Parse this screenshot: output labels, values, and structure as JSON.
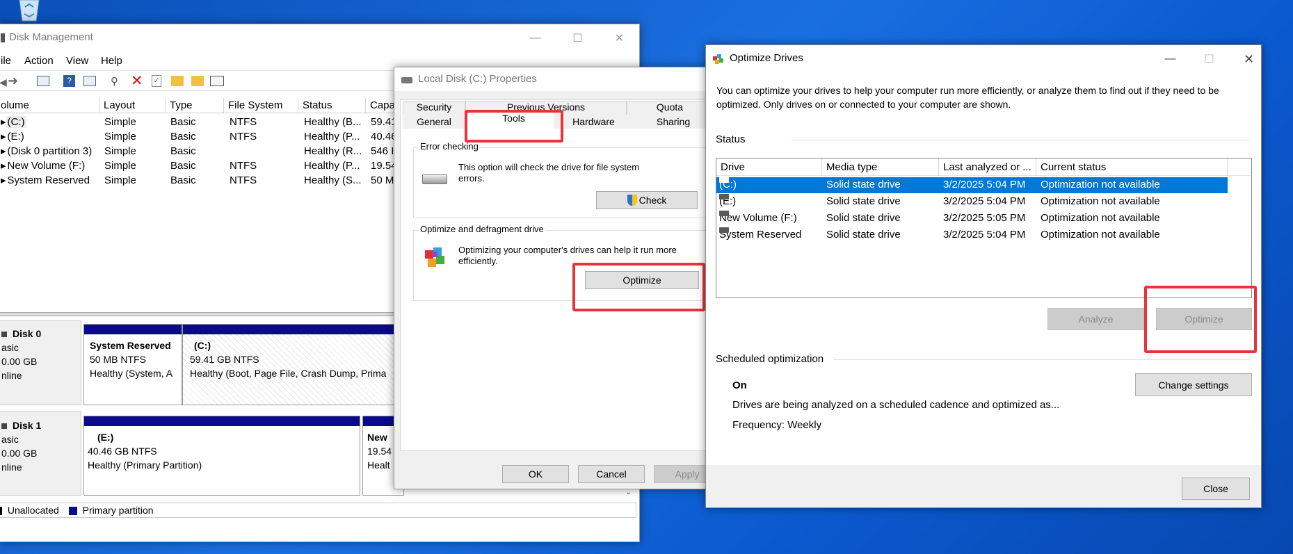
{
  "desktop": {
    "recycle_icon": "recycle-bin-icon"
  },
  "dm": {
    "title": "Disk Management",
    "menu": [
      "ile",
      "Action",
      "View",
      "Help"
    ],
    "columns": [
      "olume",
      "Layout",
      "Type",
      "File System",
      "Status",
      "Capa"
    ],
    "rows": [
      [
        "(C:)",
        "Simple",
        "Basic",
        "NTFS",
        "Healthy (B...",
        "59.41"
      ],
      [
        "(E:)",
        "Simple",
        "Basic",
        "NTFS",
        "Healthy (P...",
        "40.46"
      ],
      [
        "(Disk 0 partition 3)",
        "Simple",
        "Basic",
        "",
        "Healthy (R...",
        "546 I"
      ],
      [
        "New Volume (F:)",
        "Simple",
        "Basic",
        "NTFS",
        "Healthy (P...",
        "19.54"
      ],
      [
        "System Reserved",
        "Simple",
        "Basic",
        "NTFS",
        "Healthy (S...",
        "50 M"
      ]
    ],
    "disk0": {
      "name": "Disk 0",
      "type": "asic",
      "size": "0.00 GB",
      "state": "nline",
      "p1": {
        "name": "System Reserved",
        "size": "50 MB NTFS",
        "status": "Healthy (System, A"
      },
      "p2": {
        "name": "(C:)",
        "size": "59.41 GB NTFS",
        "status": "Healthy (Boot, Page File, Crash Dump, Prima"
      }
    },
    "disk1": {
      "name": "Disk 1",
      "type": "asic",
      "size": "0.00 GB",
      "state": "nline",
      "p1": {
        "name": "(E:)",
        "size": "40.46 GB NTFS",
        "status": "Healthy (Primary Partition)"
      },
      "p2": {
        "name": "New",
        "size": "19.54",
        "status": "Healt"
      }
    },
    "legend": {
      "unalloc": "Unallocated",
      "primary": "Primary partition"
    }
  },
  "props": {
    "title": "Local Disk (C:) Properties",
    "tabs_top": [
      "Security",
      "Previous Versions",
      "Quota"
    ],
    "tabs_bottom": [
      "General",
      "Tools",
      "Hardware",
      "Sharing"
    ],
    "err_title": "Error checking",
    "err_text": "This option will check the drive for file system errors.",
    "check": "Check",
    "opt_title": "Optimize and defragment drive",
    "opt_text": "Optimizing your computer's drives can help it run more efficiently.",
    "optimize": "Optimize",
    "ok": "OK",
    "cancel": "Cancel",
    "apply": "Apply"
  },
  "od": {
    "title": "Optimize Drives",
    "intro": "You can optimize your drives to help your computer run more efficiently, or analyze them to find out if they need to be optimized. Only drives on or connected to your computer are shown.",
    "status": "Status",
    "columns": [
      "Drive",
      "Media type",
      "Last analyzed or ...",
      "Current status"
    ],
    "rows": [
      [
        "(C:)",
        "Solid state drive",
        "3/2/2025 5:04 PM",
        "Optimization not available"
      ],
      [
        "(E:)",
        "Solid state drive",
        "3/2/2025 5:04 PM",
        "Optimization not available"
      ],
      [
        "New Volume (F:)",
        "Solid state drive",
        "3/2/2025 5:05 PM",
        "Optimization not available"
      ],
      [
        "System Reserved",
        "Solid state drive",
        "3/2/2025 5:04 PM",
        "Optimization not available"
      ]
    ],
    "analyze": "Analyze",
    "optimize": "Optimize",
    "sched": "Scheduled optimization",
    "on": "On",
    "sched_text": "Drives are being analyzed on a scheduled cadence and optimized as...",
    "freq": "Frequency: Weekly",
    "change": "Change settings",
    "close": "Close"
  },
  "colors": {
    "selection": "#0078d7",
    "highlight": "#e8333a",
    "partition": "#0a0a8a"
  }
}
